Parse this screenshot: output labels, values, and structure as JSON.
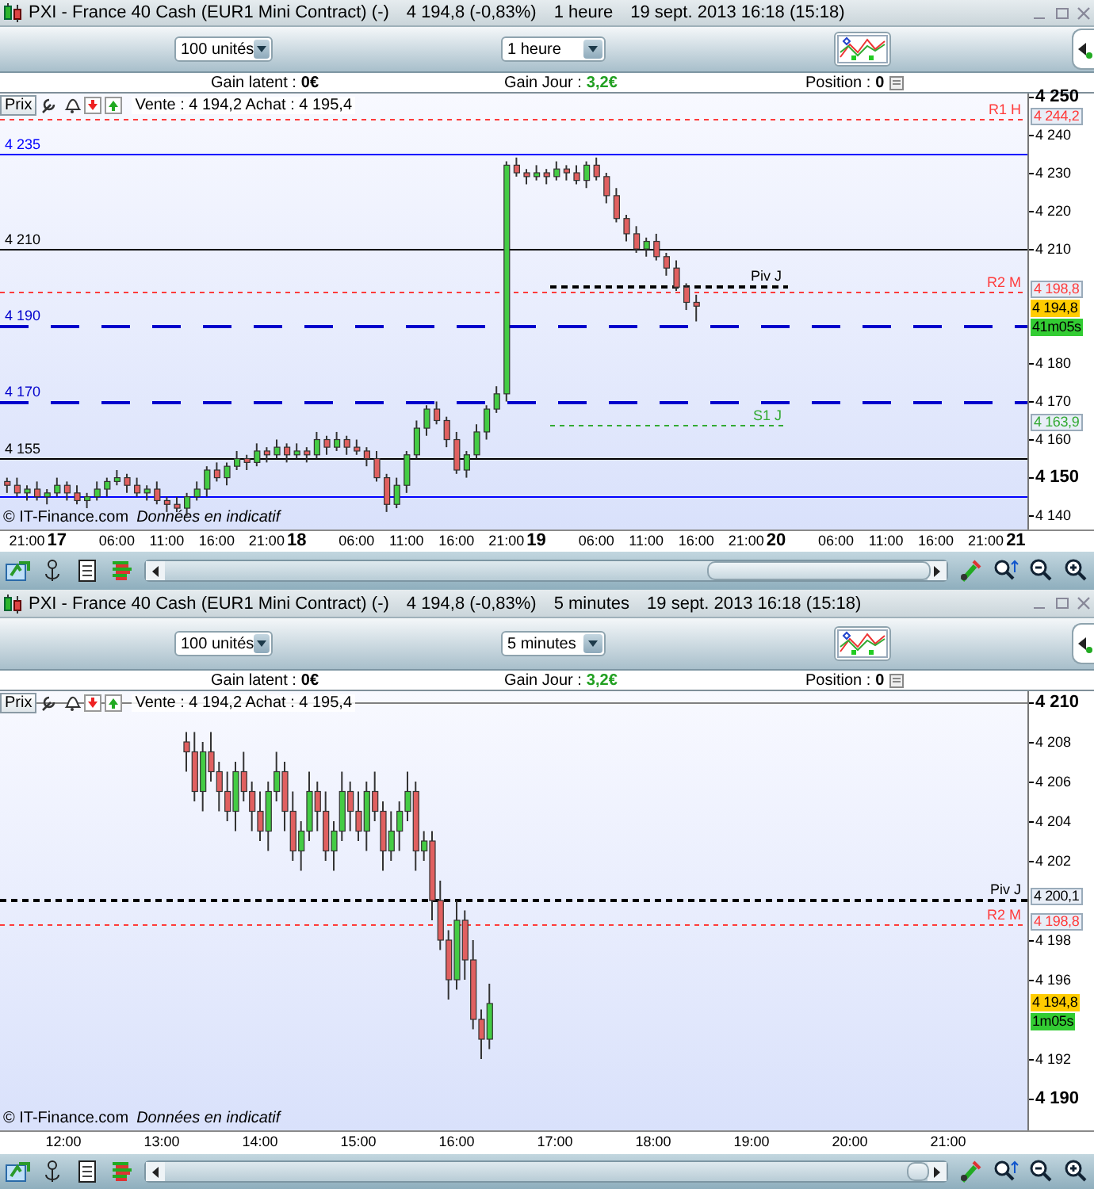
{
  "panels": [
    {
      "title": {
        "instrument": "PXI - France 40 Cash (EUR1 Mini Contract) (-)",
        "quote": "4 194,8 (-0,83%)",
        "period": "1 heure",
        "date": "19 sept. 2013 16:18 (15:18)"
      },
      "quantity_select": {
        "value": "100 unités"
      },
      "period_select": {
        "value": "1 heure"
      },
      "stats": [
        {
          "label": "Gain latent :",
          "value": "0€",
          "kind": "plain"
        },
        {
          "label": "Gain Jour :",
          "value": "3,2€",
          "kind": "gain"
        },
        {
          "label": "Position :",
          "value": "0",
          "kind": "position"
        }
      ],
      "price_tab": "Prix",
      "quote_line": "Vente : 4 194,2 Achat : 4 195,4",
      "copyright": "© IT-Finance.com",
      "disclaimer": "Données en indicatif",
      "levels": [
        {
          "kind": "pivot",
          "name": "R1 H",
          "tag": "4 244,2",
          "color": "#ff3b3b",
          "full": true
        },
        {
          "kind": "line",
          "name": "4 235",
          "color": "#0000ff",
          "full": true
        },
        {
          "kind": "line",
          "name": "4 210",
          "color": "#000000",
          "full": true
        },
        {
          "kind": "pivot",
          "name": "Piv J",
          "color": "#000000",
          "full": false
        },
        {
          "kind": "pivot",
          "name": "R2 M",
          "tag": "4 198,8",
          "color": "#ff3b3b",
          "full": true
        },
        {
          "kind": "line",
          "name": "4 190",
          "color": "#0000cc",
          "full": true
        },
        {
          "kind": "line",
          "name": "4 170",
          "color": "#0000cc",
          "full": true
        },
        {
          "kind": "pivot",
          "name": "S1 J",
          "tag": "4 163,9",
          "color": "#33aa33",
          "full": false
        },
        {
          "kind": "line",
          "name": "4 155",
          "color": "#000000",
          "full": true
        },
        {
          "kind": "line",
          "color": "#0000ff",
          "full": true
        }
      ],
      "last_price": "4 194,8",
      "countdown": "41m05s",
      "chart_data": {
        "type": "candlestick",
        "categories": [
          null,
          null,
          "21:00",
          null,
          null,
          "17",
          null,
          null,
          null,
          null,
          null,
          "06:00",
          null,
          null,
          null,
          null,
          "11:00",
          null,
          null,
          null,
          null,
          "16:00",
          null,
          null,
          null,
          null,
          "21:00",
          null,
          null,
          "18",
          null,
          null,
          null,
          null,
          null,
          "06:00",
          null,
          null,
          null,
          null,
          "11:00",
          null,
          null,
          null,
          null,
          "16:00",
          null,
          null,
          null,
          null,
          "21:00",
          null,
          null,
          "19",
          null,
          null,
          null,
          null,
          null,
          "06:00",
          null,
          null,
          null,
          null,
          "11:00",
          null,
          null,
          null,
          null,
          "16:00",
          null,
          null,
          null,
          null,
          "21:00",
          null,
          null,
          "20",
          null,
          null,
          null,
          null,
          null,
          "06:00",
          null,
          null,
          null,
          null,
          "11:00",
          null,
          null,
          null,
          null,
          "16:00",
          null,
          null,
          null,
          null,
          "21:00",
          null,
          null,
          "21"
        ],
        "ylim": [
          4136.4,
          4250.8
        ],
        "yticks": [
          {
            "value": 4250,
            "label": "4 250"
          },
          {
            "value": 4240,
            "label": "4 240"
          },
          {
            "value": 4230,
            "label": "4 230"
          },
          {
            "value": 4220,
            "label": "4 220"
          },
          {
            "value": 4210,
            "label": "4 210"
          },
          {
            "value": 4180,
            "label": "4 180"
          },
          {
            "value": 4170,
            "label": "4 170"
          },
          {
            "value": 4160,
            "label": "4 160"
          },
          {
            "value": 4150,
            "label": "4 150"
          },
          {
            "value": 4140,
            "label": "4 140"
          }
        ],
        "ohlc": [
          [
            4149,
            4150,
            4146,
            4148
          ],
          [
            4148,
            4150,
            4145,
            4146
          ],
          [
            4146,
            4148,
            4144,
            4147
          ],
          [
            4147,
            4149,
            4144,
            4145
          ],
          [
            4145,
            4147,
            4143,
            4146
          ],
          [
            4146,
            4150,
            4145,
            4148
          ],
          [
            4148,
            4149,
            4144,
            4146
          ],
          [
            4146,
            4148,
            4143,
            4144
          ],
          [
            4144,
            4146,
            4142,
            4145
          ],
          [
            4145,
            4149,
            4144,
            4147
          ],
          [
            4147,
            4150,
            4145,
            4149
          ],
          [
            4149,
            4152,
            4148,
            4150
          ],
          [
            4150,
            4151,
            4146,
            4148
          ],
          [
            4148,
            4150,
            4145,
            4146
          ],
          [
            4146,
            4148,
            4144,
            4147
          ],
          [
            4147,
            4149,
            4143,
            4144
          ],
          [
            4144,
            4145,
            4141,
            4143
          ],
          [
            4143,
            4145,
            4141,
            4142
          ],
          [
            4142,
            4146,
            4140,
            4145
          ],
          [
            4145,
            4149,
            4144,
            4147
          ],
          [
            4147,
            4153,
            4145,
            4152
          ],
          [
            4152,
            4154,
            4149,
            4150
          ],
          [
            4150,
            4154,
            4148,
            4153
          ],
          [
            4153,
            4157,
            4152,
            4155
          ],
          [
            4155,
            4156,
            4152,
            4154
          ],
          [
            4154,
            4159,
            4153,
            4157
          ],
          [
            4157,
            4158,
            4154,
            4156
          ],
          [
            4156,
            4160,
            4155,
            4158
          ],
          [
            4158,
            4159,
            4154,
            4156
          ],
          [
            4156,
            4159,
            4155,
            4157
          ],
          [
            4157,
            4158,
            4154,
            4156
          ],
          [
            4156,
            4162,
            4155,
            4160
          ],
          [
            4160,
            4161,
            4156,
            4158
          ],
          [
            4158,
            4162,
            4157,
            4160
          ],
          [
            4160,
            4161,
            4156,
            4158
          ],
          [
            4158,
            4160,
            4156,
            4157
          ],
          [
            4157,
            4158,
            4153,
            4155
          ],
          [
            4155,
            4157,
            4149,
            4150
          ],
          [
            4150,
            4151,
            4141,
            4143
          ],
          [
            4143,
            4150,
            4142,
            4148
          ],
          [
            4148,
            4157,
            4146,
            4156
          ],
          [
            4156,
            4165,
            4155,
            4163
          ],
          [
            4163,
            4169,
            4161,
            4168
          ],
          [
            4168,
            4170,
            4164,
            4165
          ],
          [
            4165,
            4166,
            4158,
            4160
          ],
          [
            4160,
            4162,
            4151,
            4152
          ],
          [
            4152,
            4157,
            4150,
            4156
          ],
          [
            4156,
            4164,
            4155,
            4162
          ],
          [
            4162,
            4169,
            4160,
            4168
          ],
          [
            4168,
            4174,
            4167,
            4172
          ],
          [
            4172,
            4233,
            4170,
            4232
          ],
          [
            4232,
            4234,
            4229,
            4230
          ],
          [
            4230,
            4231,
            4227,
            4229
          ],
          [
            4229,
            4232,
            4228,
            4230
          ],
          [
            4230,
            4231,
            4227,
            4229
          ],
          [
            4229,
            4233,
            4228,
            4231
          ],
          [
            4231,
            4232,
            4228,
            4230
          ],
          [
            4230,
            4232,
            4227,
            4228
          ],
          [
            4228,
            4233,
            4226,
            4232
          ],
          [
            4232,
            4234,
            4228,
            4229
          ],
          [
            4229,
            4230,
            4222,
            4224
          ],
          [
            4224,
            4226,
            4217,
            4218
          ],
          [
            4218,
            4219,
            4212,
            4214
          ],
          [
            4214,
            4216,
            4209,
            4210
          ],
          [
            4210,
            4213,
            4208,
            4212
          ],
          [
            4212,
            4214,
            4207,
            4208
          ],
          [
            4208,
            4209,
            4203,
            4205
          ],
          [
            4205,
            4207,
            4199,
            4200
          ],
          [
            4200,
            4201,
            4194,
            4196
          ],
          [
            4196,
            4198,
            4191,
            4195
          ],
          null,
          null,
          null,
          null,
          null,
          null,
          null,
          null,
          null,
          null,
          null,
          null,
          null,
          null,
          null,
          null,
          null,
          null,
          null,
          null,
          null,
          null,
          null,
          null,
          null,
          null,
          null,
          null,
          null,
          null,
          null,
          null
        ]
      }
    },
    {
      "title": {
        "instrument": "PXI - France 40 Cash (EUR1 Mini Contract) (-)",
        "quote": "4 194,8 (-0,83%)",
        "period": "5 minutes",
        "date": "19 sept. 2013 16:18 (15:18)"
      },
      "quantity_select": {
        "value": "100 unités"
      },
      "period_select": {
        "value": "5 minutes"
      },
      "stats": [
        {
          "label": "Gain latent :",
          "value": "0€",
          "kind": "plain"
        },
        {
          "label": "Gain Jour :",
          "value": "3,2€",
          "kind": "gain"
        },
        {
          "label": "Position :",
          "value": "0",
          "kind": "position"
        }
      ],
      "price_tab": "Prix",
      "quote_line": "Vente : 4 194,2 Achat : 4 195,4",
      "copyright": "© IT-Finance.com",
      "disclaimer": "Données en indicatif",
      "levels": [
        {
          "kind": "line",
          "color": "#808080",
          "full": true
        },
        {
          "kind": "pivot",
          "name": "Piv J",
          "tag": "4 200,1",
          "color": "#000000",
          "full": true
        },
        {
          "kind": "pivot",
          "name": "R2 M",
          "tag": "4 198,8",
          "color": "#ff3b3b",
          "full": true
        }
      ],
      "last_price": "4 194,8",
      "countdown": "1m05s",
      "chart_data": {
        "type": "candlestick",
        "x": [
          13.25,
          13.333,
          13.417,
          13.5,
          13.583,
          13.667,
          13.75,
          13.833,
          13.917,
          14,
          14.083,
          14.167,
          14.25,
          14.333,
          14.417,
          14.5,
          14.583,
          14.667,
          14.75,
          14.833,
          14.917,
          15,
          15.083,
          15.167,
          15.25,
          15.333,
          15.417,
          15.5,
          15.583,
          15.667,
          15.75,
          15.833,
          15.917,
          16,
          16.083,
          16.167,
          16.25,
          16.333
        ],
        "ylim": [
          4188.4,
          4210.56
        ],
        "yticks": [
          {
            "value": 4210,
            "label": "4 210"
          },
          {
            "value": 4208,
            "label": "4 208"
          },
          {
            "value": 4206,
            "label": "4 206"
          },
          {
            "value": 4204,
            "label": "4 204"
          },
          {
            "value": 4202,
            "label": "4 202"
          },
          {
            "value": 4198,
            "label": "4 198"
          },
          {
            "value": 4196,
            "label": "4 196"
          },
          {
            "value": 4192,
            "label": "4 192"
          },
          {
            "value": 4190,
            "label": "4 190"
          }
        ],
        "xlim": [
          11.355,
          22.484
        ],
        "xticks": [
          {
            "value": 12,
            "label": "12:00"
          },
          {
            "value": 13,
            "label": "13:00"
          },
          {
            "value": 14,
            "label": "14:00"
          },
          {
            "value": 15,
            "label": "15:00"
          },
          {
            "value": 16,
            "label": "16:00"
          },
          {
            "value": 17,
            "label": "17:00"
          },
          {
            "value": 18,
            "label": "18:00"
          },
          {
            "value": 19,
            "label": "19:00"
          },
          {
            "value": 20,
            "label": "20:00"
          },
          {
            "value": 21,
            "label": "21:00"
          }
        ],
        "ohlc": [
          [
            4208,
            4208.5,
            4206.5,
            4207.5
          ],
          [
            4207.5,
            4208.5,
            4205,
            4205.5
          ],
          [
            4205.5,
            4208,
            4204.5,
            4207.5
          ],
          [
            4207.5,
            4208.5,
            4206,
            4206.5
          ],
          [
            4206.5,
            4207,
            4204.5,
            4205.5
          ],
          [
            4205.5,
            4206.5,
            4204,
            4204.5
          ],
          [
            4204.5,
            4207,
            4203.5,
            4206.5
          ],
          [
            4206.5,
            4207.5,
            4205,
            4205.5
          ],
          [
            4205.5,
            4206,
            4203.5,
            4204.5
          ],
          [
            4204.5,
            4205.5,
            4203,
            4203.5
          ],
          [
            4203.5,
            4206,
            4202.5,
            4205.5
          ],
          [
            4205.5,
            4207.5,
            4205,
            4206.5
          ],
          [
            4206.5,
            4207,
            4203.5,
            4204.5
          ],
          [
            4204.5,
            4205.5,
            4202,
            4202.5
          ],
          [
            4202.5,
            4204,
            4201.5,
            4203.5
          ],
          [
            4203.5,
            4206.5,
            4203,
            4205.5
          ],
          [
            4205.5,
            4206,
            4203.5,
            4204.5
          ],
          [
            4204.5,
            4205.5,
            4202,
            4202.5
          ],
          [
            4202.5,
            4204,
            4201.5,
            4203.5
          ],
          [
            4203.5,
            4206.5,
            4203,
            4205.5
          ],
          [
            4205.5,
            4206,
            4203.5,
            4204.5
          ],
          [
            4204.5,
            4205.5,
            4203,
            4203.5
          ],
          [
            4203.5,
            4206,
            4202.5,
            4205.5
          ],
          [
            4205.5,
            4206.5,
            4204,
            4204.5
          ],
          [
            4204.5,
            4205,
            4201.5,
            4202.5
          ],
          [
            4202.5,
            4204.5,
            4202,
            4203.5
          ],
          [
            4203.5,
            4205,
            4202.5,
            4204.5
          ],
          [
            4204.5,
            4206.5,
            4204,
            4205.5
          ],
          [
            4205.5,
            4206,
            4201.5,
            4202.5
          ],
          [
            4202.5,
            4203.5,
            4202,
            4203
          ],
          [
            4203,
            4203.5,
            4199,
            4200
          ],
          [
            4200,
            4201,
            4197.5,
            4198
          ],
          [
            4198,
            4198.5,
            4195,
            4196
          ],
          [
            4196,
            4200,
            4195.5,
            4199
          ],
          [
            4199,
            4199.5,
            4196,
            4197
          ],
          [
            4197,
            4198,
            4193.5,
            4194
          ],
          [
            4194,
            4194.5,
            4192,
            4193
          ],
          [
            4193,
            4195.8,
            4192.5,
            4194.8
          ]
        ]
      }
    }
  ]
}
